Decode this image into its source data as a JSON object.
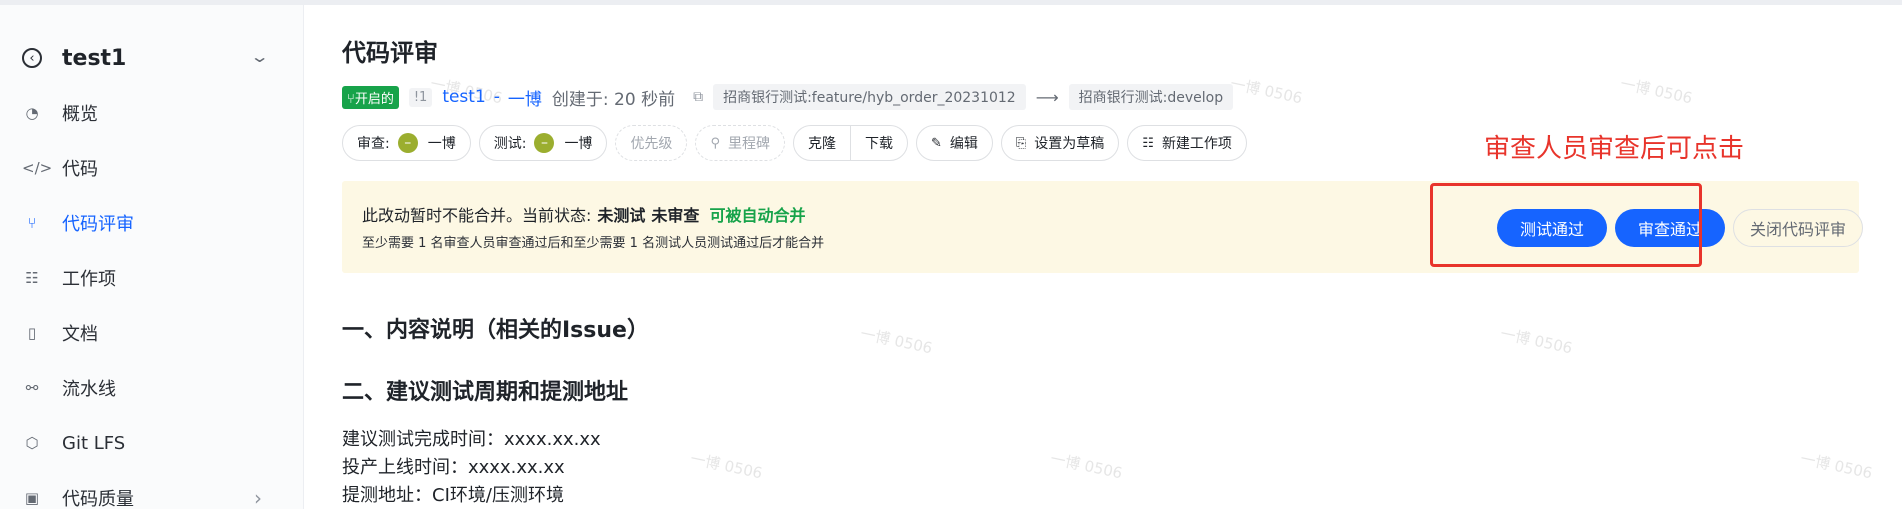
{
  "sidebar": {
    "project_name": "test1",
    "items": [
      {
        "label": "概览",
        "icon": "gauge-icon"
      },
      {
        "label": "代码",
        "icon": "code-icon"
      },
      {
        "label": "代码评审",
        "icon": "merge-request-icon",
        "active": true
      },
      {
        "label": "工作项",
        "icon": "workitem-icon"
      },
      {
        "label": "文档",
        "icon": "book-icon"
      },
      {
        "label": "流水线",
        "icon": "pipeline-icon"
      },
      {
        "label": "Git LFS",
        "icon": "cube-icon"
      },
      {
        "label": "代码质量",
        "icon": "quality-icon"
      }
    ]
  },
  "header": {
    "title": "代码评审",
    "status_badge": "开启的",
    "mr_id": "!1",
    "repo": "test1",
    "separator": "-",
    "author": "一博",
    "created": "创建于: 20 秒前",
    "source_branch": "招商银行测试:feature/hyb_order_20231012",
    "target_branch": "招商银行测试:develop"
  },
  "toolbar": {
    "reviewer_label": "审查:",
    "reviewer_name": "一博",
    "tester_label": "测试:",
    "tester_name": "一博",
    "priority": "优先级",
    "milestone": "里程碑",
    "clone": "克隆",
    "download": "下载",
    "edit": "编辑",
    "draft": "设置为草稿",
    "new_workitem": "新建工作项"
  },
  "notice": {
    "prefix": "此改动暂时不能合并。当前状态:",
    "status_untested": "未测试",
    "status_unreviewed": "未审查",
    "status_auto": "可被自动合并",
    "detail": "至少需要 1 名审查人员审查通过后和至少需要 1 名测试人员测试通过后才能合并",
    "test_pass": "测试通过",
    "review_pass": "审查通过",
    "close": "关闭代码评审"
  },
  "annotation": "审查人员审查后可点击",
  "content": {
    "h1": "一、内容说明（相关的Issue）",
    "h2": "二、建议测试周期和提测地址",
    "lines": [
      "建议测试完成时间：xxxx.xx.xx",
      "投产上线时间：xxxx.xx.xx",
      "提测地址：CI环境/压测环境"
    ]
  },
  "watermark": "一博 0506",
  "colors": {
    "accent": "#1664ff",
    "success": "#17a34a",
    "annotation": "#e8342b",
    "notice_bg": "#fdf8e4"
  }
}
